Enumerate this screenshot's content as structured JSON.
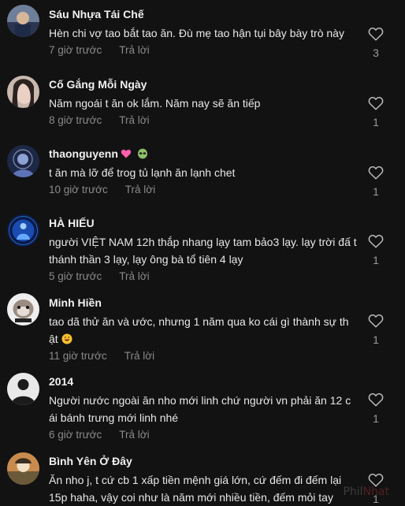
{
  "comments": [
    {
      "name": "Sáu Nhựa Tái Chế",
      "text": "Hèn chi vợ tao bắt tao ăn. Đù mẹ tao hận tụi bây bày trò này",
      "time": "7 giờ trước",
      "reply": "Trả lời",
      "likes": "3"
    },
    {
      "name": "Cố Gắng Mỗi Ngày",
      "text": "Năm ngoái t ăn ok lắm. Năm nay sẽ ăn tiếp",
      "time": "8 giờ trước",
      "reply": "Trả lời",
      "likes": "1"
    },
    {
      "name": "thaonguyenn",
      "text": "t ăn mà lỡ để trog tủ lạnh ăn lạnh chet",
      "time": "10 giờ trước",
      "reply": "Trả lời",
      "likes": "1"
    },
    {
      "name": "HÀ HIẾU",
      "text": "người VIỆT NAM 12h thắp nhang lạy tam bảo3 lạy. lạy trời đấ t thánh thần 3 lạy, lạy ông bà tổ tiên 4 lạy",
      "time": "5 giờ trước",
      "reply": "Trả lời",
      "likes": "1"
    },
    {
      "name": "Minh Hiền",
      "text": "tao dã thử ăn và ước, nhưng 1 năm qua ko cái gì thành sự th ật",
      "time": "11 giờ trước",
      "reply": "Trả lời",
      "likes": "1"
    },
    {
      "name": "2014",
      "text": "Người nước ngoài ăn nho mới linh chứ người vn phải ăn 12 c ái bánh trưng mới linh nhé",
      "time": "6 giờ trước",
      "reply": "Trả lời",
      "likes": "1"
    },
    {
      "name": "Bình Yên Ở Đây",
      "text": "Ăn nho j, t cứ cb 1 xấp tiền mệnh giá lớn, cứ đếm đi đếm lại 15p haha, vậy coi như là năm mới nhiều tiền, đếm mỏi tay",
      "time": "",
      "reply": "",
      "likes": "1"
    }
  ],
  "watermark": {
    "part1": "Phil",
    "part2": "Nhat"
  },
  "colors": {
    "background": "#121212",
    "meta": "#8a8a8a"
  }
}
